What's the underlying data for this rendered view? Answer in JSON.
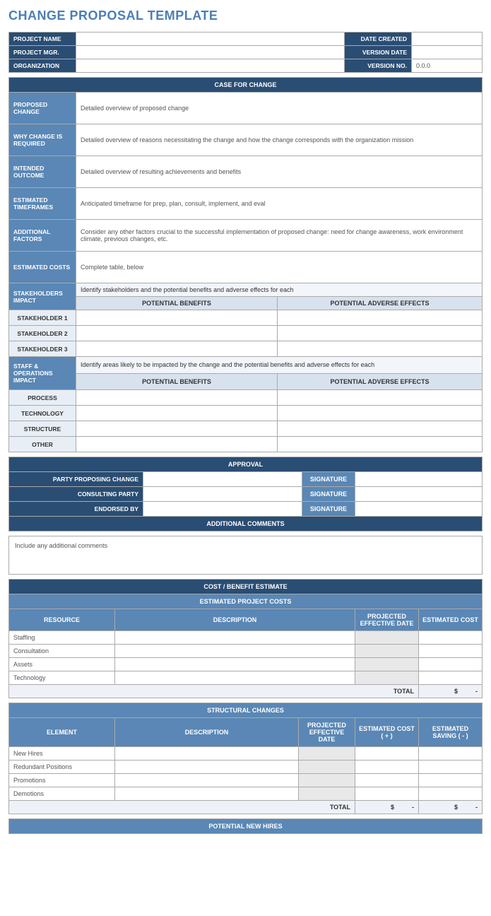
{
  "title": "CHANGE PROPOSAL TEMPLATE",
  "project": {
    "name_label": "PROJECT NAME",
    "mgr_label": "PROJECT MGR.",
    "org_label": "ORGANIZATION",
    "date_created_label": "DATE CREATED",
    "version_date_label": "VERSION DATE",
    "version_no_label": "VERSION NO.",
    "version_no_value": "0.0.0"
  },
  "case_for_change": {
    "header": "CASE FOR CHANGE",
    "proposed_change_label": "PROPOSED CHANGE",
    "proposed_change_value": "Detailed overview of proposed change",
    "why_required_label": "WHY CHANGE IS REQUIRED",
    "why_required_value": "Detailed overview of reasons necessitating the change and how the change corresponds with the organization mission",
    "outcome_label": "INTENDED OUTCOME",
    "outcome_value": "Detailed overview of resulting achievements and benefits",
    "timeframes_label": "ESTIMATED TIMEFRAMES",
    "timeframes_value": "Anticipated timeframe for prep, plan, consult, implement, and eval",
    "factors_label": "ADDITIONAL FACTORS",
    "factors_value": "Consider any other factors crucial to the successful implementation of proposed change: need for change awareness, work environment climate, previous changes, etc.",
    "costs_label": "ESTIMATED COSTS",
    "costs_value": "Complete table, below",
    "stakeholders_label": "STAKEHOLDERS IMPACT",
    "stakeholders_desc": "Identify stakeholders and the potential benefits and adverse effects for each",
    "benefits_header": "POTENTIAL BENEFITS",
    "adverse_header": "POTENTIAL ADVERSE EFFECTS",
    "stakeholder1": "STAKEHOLDER 1",
    "stakeholder2": "STAKEHOLDER 2",
    "stakeholder3": "STAKEHOLDER 3",
    "staff_ops_label": "STAFF & OPERATIONS IMPACT",
    "staff_ops_desc": "Identify areas likely to be impacted by the change and the potential benefits and adverse effects for each",
    "process": "PROCESS",
    "technology": "TECHNOLOGY",
    "structure": "STRUCTURE",
    "other": "OTHER"
  },
  "approval": {
    "header": "APPROVAL",
    "party_proposing": "PARTY PROPOSING CHANGE",
    "consulting": "CONSULTING PARTY",
    "endorsed": "ENDORSED BY",
    "signature": "SIGNATURE",
    "comments_header": "ADDITIONAL COMMENTS",
    "comments_value": "Include any additional comments"
  },
  "cost_benefit": {
    "header": "COST / BENEFIT ESTIMATE",
    "project_costs_header": "ESTIMATED PROJECT COSTS",
    "resource": "RESOURCE",
    "description": "DESCRIPTION",
    "projected_date": "PROJECTED EFFECTIVE DATE",
    "estimated_cost": "ESTIMATED COST",
    "staffing": "Staffing",
    "consultation": "Consultation",
    "assets": "Assets",
    "technology": "Technology",
    "total": "TOTAL",
    "currency": "$",
    "dash": "-",
    "structural_header": "STRUCTURAL CHANGES",
    "element": "ELEMENT",
    "est_cost_plus": "ESTIMATED COST ( + )",
    "est_saving_minus": "ESTIMATED SAVING ( - )",
    "new_hires": "New Hires",
    "redundant": "Redundant Positions",
    "promotions": "Promotions",
    "demotions": "Demotions",
    "potential_hires_header": "POTENTIAL NEW HIRES"
  }
}
